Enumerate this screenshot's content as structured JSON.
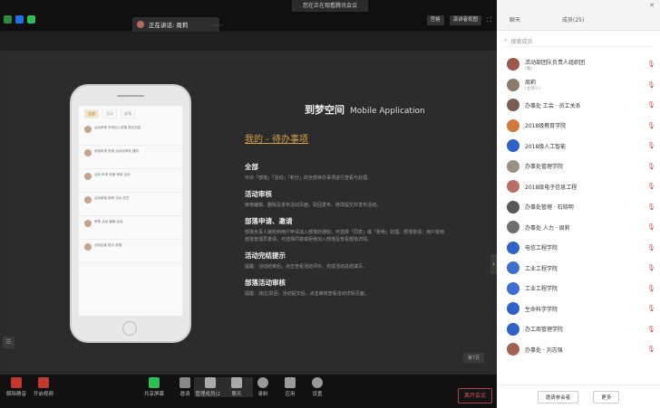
{
  "window": {
    "title": "您在正在观看腾讯会议"
  },
  "topbar": {
    "speaker": "正在讲话: 周莉",
    "sound_wave": "〰〰",
    "btn_grid": "宫格",
    "btn_view": "演讲者视图",
    "colors": {
      "bg": "#0f0f0f",
      "accent": "#1a73e8"
    }
  },
  "slide": {
    "title": "到梦空间",
    "title_en": "Mobile Application",
    "subtitle": "我的 - 待办事项",
    "page": "第7页",
    "phone": {
      "tabs": [
        "全部",
        "活动",
        "部落"
      ],
      "rows": [
        "活动审核 申请加入部落 报名信息",
        "部落申请 邀请 活动待审核 通知",
        "活动 申请 部落 审核 活动",
        "活动审核 推荐 活动 成员",
        "审核 活动 编辑 活动",
        "活动结束 提示 部落"
      ]
    },
    "sections": [
      {
        "h": "全部",
        "b": "可对「部落」「活动」「积分」的全部待办事项进行查看与处理。"
      },
      {
        "h": "活动审核",
        "b": "审核编辑、删除及发布活动页面，驳回发布、修改提交并发布活动。"
      },
      {
        "h": "部落申请、邀请",
        "b": "部落负责人接收到用户申请加入部落的通知，可选择「同意」或「拒绝」处理。部落邀请：用户受到部落管理员邀请，可选择同意或拒绝加入部落及查看部落详情。"
      },
      {
        "h": "活动完结提示",
        "b": "提醒：活动结束后，点击查看活动评价、完成活动总结填写。"
      },
      {
        "h": "部落活动审核",
        "b": "提醒：通过/驳回、活动提交后，点击审核查看活动详情页面。"
      }
    ]
  },
  "bottombar": {
    "items": [
      "解除静音",
      "开启视频",
      "共享屏幕",
      "邀请",
      "管理成员(25)",
      "聊天",
      "录制",
      "应用",
      "设置"
    ],
    "leave": "离开会议"
  },
  "panel": {
    "tab_members": "聊天",
    "tab_members2": "成员(25)",
    "search_placeholder": "搜索成员",
    "members": [
      {
        "name": "活动部团队负责人组织团",
        "sub": "(我)",
        "color": "#a1564c"
      },
      {
        "name": "周莉",
        "sub": "(主持人)",
        "color": "#8b7b6a"
      },
      {
        "name": "办事处 工会 · 员工关系",
        "sub": "",
        "color": "#7a5d4f"
      },
      {
        "name": "2018级教育学院",
        "sub": "",
        "color": "#d07a3a"
      },
      {
        "name": "2018级人工智能",
        "sub": "",
        "color": "#2f62c9"
      },
      {
        "name": "办事处管理学院",
        "sub": "",
        "color": "#9c8f83"
      },
      {
        "name": "2018级电子信息工程",
        "sub": "",
        "color": "#bb6e66"
      },
      {
        "name": "办事处管理 · 石晓明",
        "sub": "",
        "color": "#595959"
      },
      {
        "name": "办事处 人力 · 周莉",
        "sub": "",
        "color": "#6e6e6e"
      },
      {
        "name": "电信工程学院",
        "sub": "",
        "color": "#2f62c9"
      },
      {
        "name": "工业工程学院",
        "sub": "",
        "color": "#3d6fd1"
      },
      {
        "name": "工业工程学院",
        "sub": "",
        "color": "#3d6fd1"
      },
      {
        "name": "生命科学学院",
        "sub": "",
        "color": "#2f62c9"
      },
      {
        "name": "办工商管理学院",
        "sub": "",
        "color": "#2f62c9"
      },
      {
        "name": "办事处 · 刘志强",
        "sub": "",
        "color": "#a26252"
      }
    ],
    "btn_left": "邀请参会者",
    "btn_right": "更多"
  }
}
